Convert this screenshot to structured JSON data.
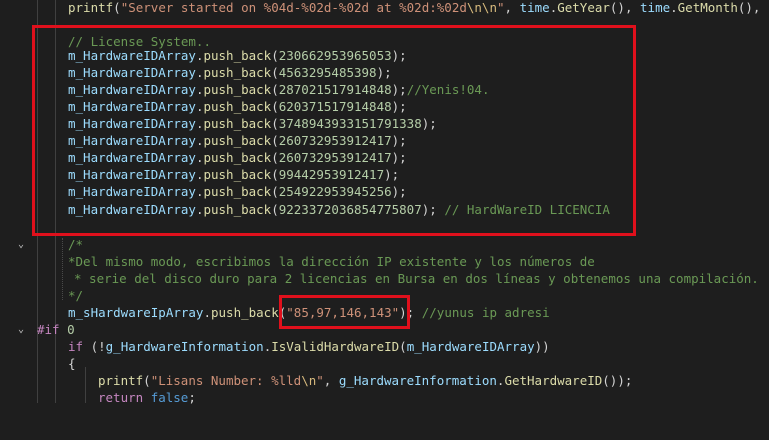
{
  "lines": {
    "l0": {
      "fn1": "printf",
      "p1": "(",
      "str": "\"Server started on %04d-%02d-%02d at %02d:%02d",
      "esc": "\\n\\n",
      "strend": "\"",
      "p2": ", ",
      "v1": "time",
      "d1": ".",
      "f2": "GetYear",
      "p3": "(), ",
      "v2": "time",
      "d2": ".",
      "f3": "GetMonth",
      "p4": "(),"
    },
    "l2": {
      "cmt": "// License System.."
    },
    "l3": {
      "var": "m_HardwareIDArray",
      "dot": ".",
      "fn": "push_back",
      "po": "(",
      "num": "230662953965053",
      "pc": ");"
    },
    "l4": {
      "var": "m_HardwareIDArray",
      "dot": ".",
      "fn": "push_back",
      "po": "(",
      "num": "4563295485398",
      "pc": ");"
    },
    "l5": {
      "var": "m_HardwareIDArray",
      "dot": ".",
      "fn": "push_back",
      "po": "(",
      "num": "287021517914848",
      "pc": ");",
      "cmt": "//Yenis!04."
    },
    "l6": {
      "var": "m_HardwareIDArray",
      "dot": ".",
      "fn": "push_back",
      "po": "(",
      "num": "620371517914848",
      "pc": ");"
    },
    "l7": {
      "var": "m_HardwareIDArray",
      "dot": ".",
      "fn": "push_back",
      "po": "(",
      "num": "3748943933151791338",
      "pc": ");"
    },
    "l8": {
      "var": "m_HardwareIDArray",
      "dot": ".",
      "fn": "push_back",
      "po": "(",
      "num": "260732953912417",
      "pc": ");"
    },
    "l9": {
      "var": "m_HardwareIDArray",
      "dot": ".",
      "fn": "push_back",
      "po": "(",
      "num": "260732953912417",
      "pc": ");"
    },
    "l10": {
      "var": "m_HardwareIDArray",
      "dot": ".",
      "fn": "push_back",
      "po": "(",
      "num": "99442953912417",
      "pc": ");"
    },
    "l11": {
      "var": "m_HardwareIDArray",
      "dot": ".",
      "fn": "push_back",
      "po": "(",
      "num": "254922953945256",
      "pc": ");"
    },
    "l12": {
      "var": "m_HardwareIDArray",
      "dot": ".",
      "fn": "push_back",
      "po": "(",
      "num": "9223372036854775807",
      "pc": ");",
      "cmt": " // HardWareID LICENCIA"
    },
    "l14": {
      "cmt": "/*"
    },
    "l15": {
      "cmt": "*Del mismo modo, escribimos la dirección IP existente y los números de"
    },
    "l16": {
      "cmt": "* serie del disco duro para 2 licencias en Bursa en dos líneas y obtenemos una compilación."
    },
    "l17": {
      "cmt": "*/"
    },
    "l18": {
      "var": "m_sHardwareIpArray",
      "dot": ".",
      "fn": "push_back",
      "po": "(",
      "str": "\"85,97,146,143\"",
      "pc": ");",
      "cmt": " //yunus ip adresi"
    },
    "l19": {
      "pre": "#if",
      "num": " 0"
    },
    "l20": {
      "kw": "if",
      "p1": " (!",
      "var": "g_HardwareInformation",
      "dot": ".",
      "fn": "IsValidHardwareID",
      "po": "(",
      "var2": "m_HardwareIDArray",
      "pc": "))"
    },
    "l21": {
      "p": "{"
    },
    "l22": {
      "fn": "printf",
      "po": "(",
      "str": "\"Lisans Number: %lld",
      "esc": "\\n",
      "strend": "\"",
      "p2": ", ",
      "var": "g_HardwareInformation",
      "dot": ".",
      "fn2": "GetHardwareID",
      "pc": "());"
    },
    "l23": {
      "kw": "return",
      "sp": " ",
      "kw2": "false",
      "pc": ";"
    }
  },
  "fold_icon": "chevron-down-icon",
  "accent": "#e0101c"
}
